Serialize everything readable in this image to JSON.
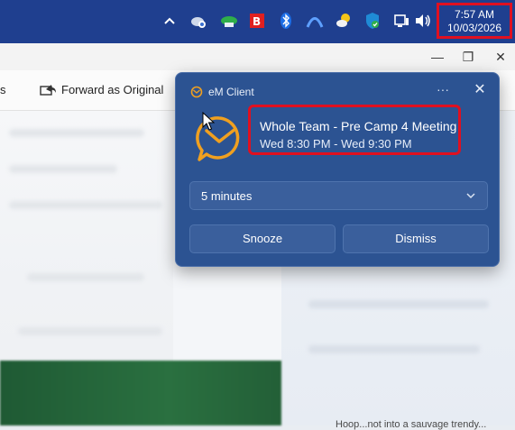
{
  "taskbar": {
    "tray_icons": [
      "chevron-up-icon",
      "cloud-sync-icon",
      "network-globe-icon",
      "security-b-icon",
      "bluetooth-icon",
      "vpn-arc-icon",
      "weather-icon",
      "defender-shield-icon",
      "network-wired-icon",
      "volume-icon"
    ],
    "clock_time": "7:57 AM",
    "clock_date": "10/03/2026"
  },
  "app": {
    "window_controls": {
      "minimize": "—",
      "restore": "❐",
      "close": "✕"
    },
    "toolbar": {
      "prev_label_fragment": "s",
      "forward_label": "Forward as Original"
    },
    "bottom_text": "Hoop...not into a sauvage trendy..."
  },
  "toast": {
    "app_name": "eM Client",
    "more_label": "···",
    "close_label": "✕",
    "event_title": "Whole Team - Pre Camp 4 Meeting",
    "event_time": "Wed 8:30 PM - Wed 9:30 PM",
    "snooze_selected": "5 minutes",
    "snooze_button": "Snooze",
    "dismiss_button": "Dismiss",
    "accent_color": "#f0a020",
    "highlight_color": "#e01020"
  }
}
